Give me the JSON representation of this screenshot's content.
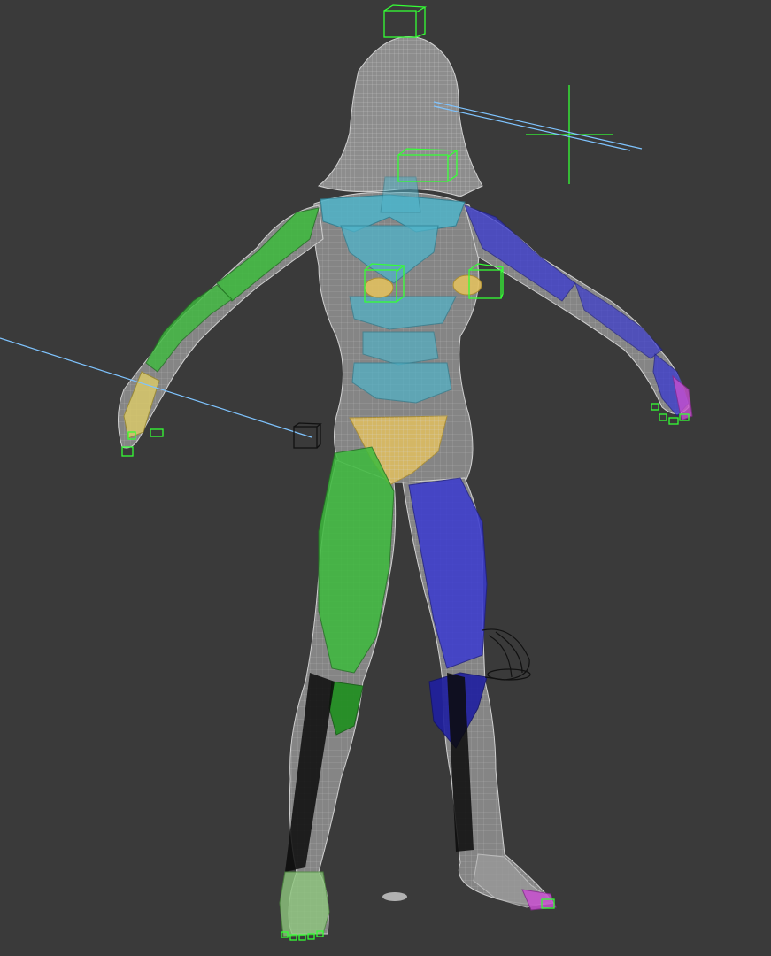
{
  "viewport": {
    "background": "#3a3a3a",
    "label": ""
  },
  "colors": {
    "wireframe": "#c8c8c8",
    "skin_fill": "#8a8a8a",
    "spine_bones": "#4fb3c9",
    "left_side_bones": "#3dbb3d",
    "right_side_bones": "#3a3ad0",
    "pelvis_bone": "#e2c060",
    "helper_boxes": "#35ff35",
    "target_lines": "#7fc4ff",
    "finger_accent_right": "#c84fd0",
    "dark_helpers": "#0a0a0a"
  },
  "scene": {
    "icons": [
      "head-helper-box-icon",
      "eye-target-crosshair-icon",
      "camera-target-box-icon",
      "ik-swivel-helper-icon"
    ]
  }
}
